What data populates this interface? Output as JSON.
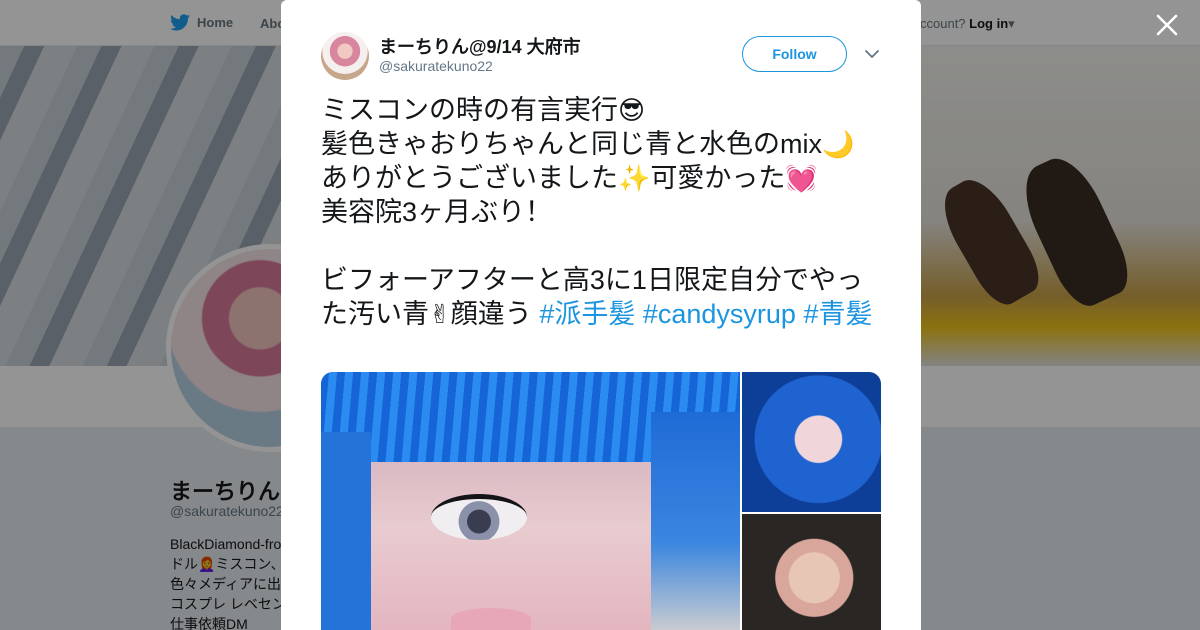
{
  "background_page": {
    "nav": {
      "home_label": "Home",
      "about_label": "Abo",
      "login_prefix": "ccount?",
      "login_label": "Log in"
    },
    "profile": {
      "name": "まーちりん(",
      "handle": "@sakuratekuno22",
      "bio_lines": [
        "BlackDiamond-fro",
        "ドル👩‍🦰ミスコン、",
        "色々メディアに出",
        "コスプレ レベセン",
        "仕事依頼DM"
      ]
    }
  },
  "tweet": {
    "author_name": "まーちりん@9/14 大府市",
    "author_handle": "@sakuratekuno22",
    "follow_label": "Follow",
    "text_lines": [
      "ミスコンの時の有言実行",
      "髪色きゃおりちゃんと同じ青と水色のmix",
      "ありがとうございました",
      "可愛かった",
      "美容院3ヶ月ぶり！",
      "ビフォーアフターと高3に1日限定自分でやった汚い青",
      "顔違う"
    ],
    "emojis": {
      "sunglasses": "😎",
      "moon": "🌙",
      "sparkles": "✨",
      "heart": "💓",
      "victory": "✌"
    },
    "hashtags": [
      "#派手髪",
      "#candysyrup",
      "#青髪"
    ]
  },
  "colors": {
    "link": "#1b95e0",
    "text": "#14171a",
    "muted": "#657786"
  },
  "icons": [
    "twitter-bird-icon",
    "close-icon",
    "chevron-down-icon"
  ]
}
